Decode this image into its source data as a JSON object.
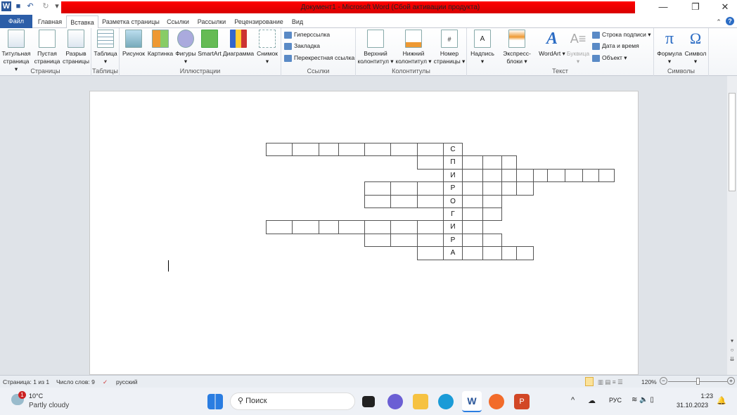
{
  "window": {
    "title": "Документ1 - Microsoft Word (Сбой активации продукта)",
    "minimize": "—",
    "restore": "❐",
    "close": "✕"
  },
  "quick_access": {
    "word": "W",
    "save": "💾",
    "undo": "↶",
    "redo": "↻",
    "customize": "▾"
  },
  "tabs": [
    "Файл",
    "Главная",
    "Вставка",
    "Разметка страницы",
    "Ссылки",
    "Рассылки",
    "Рецензирование",
    "Вид"
  ],
  "ribbon": {
    "pages": {
      "label": "Страницы",
      "items": [
        "Титульная страница ▾",
        "Пустая страница",
        "Разрыв страницы"
      ]
    },
    "tables": {
      "label": "Таблицы",
      "items": [
        "Таблица ▾"
      ]
    },
    "illustrations": {
      "label": "Иллюстрации",
      "items": [
        "Рисунок",
        "Картинка",
        "Фигуры ▾",
        "SmartArt",
        "Диаграмма",
        "Снимок ▾"
      ]
    },
    "links": {
      "label": "Ссылки",
      "items": [
        "Гиперссылка",
        "Закладка",
        "Перекрестная ссылка"
      ]
    },
    "headers": {
      "label": "Колонтитулы",
      "items": [
        "Верхний колонтитул ▾",
        "Нижний колонтитул ▾",
        "Номер страницы ▾"
      ]
    },
    "text": {
      "label": "Текст",
      "items": [
        "Надпись ▾",
        "Экспресс-блоки ▾",
        "WordArt ▾",
        "Буквица ▾"
      ],
      "small": [
        "Строка подписи ▾",
        "Дата и время",
        "Объект ▾"
      ]
    },
    "symbols": {
      "label": "Символы",
      "items": [
        "Формула ▾",
        "Символ ▾"
      ]
    }
  },
  "crossword": {
    "letters": [
      "С",
      "П",
      "И",
      "Р",
      "О",
      "Г",
      "И",
      "Р",
      "А"
    ]
  },
  "status": {
    "page": "Страница: 1 из 1",
    "words": "Число слов: 9",
    "language": "русский",
    "zoom": "120%",
    "zoom_minus": "−",
    "zoom_plus": "+"
  },
  "taskbar": {
    "weather_temp": "10°C",
    "weather_desc": "Partly cloudy",
    "weather_badge": "1",
    "search_placeholder": "Поиск",
    "lang": "РУС",
    "time": "1:23",
    "date": "31.10.2023"
  }
}
